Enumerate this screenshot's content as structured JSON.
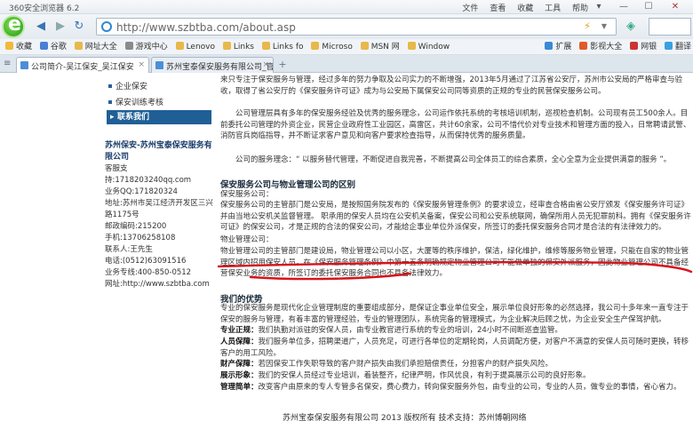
{
  "browser": {
    "title": "360安全浏览器 6.2",
    "menus": [
      "文件",
      "查看",
      "收藏",
      "工具",
      "帮助"
    ],
    "window_controls": [
      "▾",
      "—",
      "☐",
      "✕"
    ],
    "url": "http://www.szbtba.com/about.asp",
    "bookmarks": [
      "收藏",
      "谷歌",
      "网址大全",
      "游戏中心",
      "Lenovo",
      "Links",
      "Links fo",
      "Microso",
      "MSN 网",
      "Window"
    ],
    "bookmarks_right": [
      "扩展",
      "影视大全",
      "网银",
      "翻译"
    ],
    "tabs": [
      {
        "label": "公司简介-吴江保安_吴江保安",
        "active": true
      },
      {
        "label": "苏州宝泰保安服务有限公司_官",
        "active": false
      }
    ]
  },
  "sidebar": {
    "links": [
      "企业保安",
      "保安训练考核"
    ],
    "contact_title": "联系我们",
    "company": "苏州保安-苏州宝泰保安服务有限公司",
    "lines": [
      "客服支持:1718203240qq.com",
      "业务QQ:171820324",
      "地址:苏州市吴江经济开发区三兴路1175号",
      "邮政编码:215200",
      "手机:13706258108",
      "联系人:王先生",
      "电话:(0512)63091516",
      "业务专线:400-850-0512",
      "网址:http://www.szbtba.com"
    ]
  },
  "content": {
    "p1": "来只专注于保安服务与管理，经过多年的努力争取及公司实力的不断增强，2013年5月通过了江苏省公安厅，苏州市公安局的严格审查与验收，取得了省公安厅的《保安服务许可证》成为与公安局下属保安公司同等资质的正规的专业的民营保安服务公司。",
    "p2": "公司管理层具有多年的保安服务经验及优秀的服务理念，公司运作依托系统的考核培训机制，巡视检查机制。公司现有员工500余人。目前委托公司管理的外资企业，民营企业政府性工业园区，高雷区，共计60余家，公司不惜代价对专业技术和管理方面的投入，日常聘请武警、消防官兵岗临指导，并不断证求客户意见和向客户要求检查指导，从而保持优秀的服务质量。",
    "p3": "公司的服务理念：“ 以服务替代管理，不断促进自我完善，不断提高公司全体员工的综合素质，全心全意为企业提供满意的服务 ”。",
    "h1": "保安服务公司与物业管理公司的区别",
    "s1_label": "保安服务公司：",
    "s1": "保安服务公司的主管部门是公安局，是按照国务院发布的《保安服务管理条例》的要求设立，经审查合格由省公安厅颁发《保安服务许可证》并由当地公安机关监督管理。 职承用的保安人员均在公安机关备案，保安公司和公安系统联网，确保所用人员无犯罪前科。拥有《保安服务许可证》的保安公司，才是正规的合法的保安公司，才能给企事业单位外派保安，所签订的委托保安服务合同才是合法的有法律效力的。",
    "s2_label": "物业管理公司：",
    "s2": "物业管理公司的主管部门是建设局，物业管理公司以小区，大厦等的秩序维护，保洁，绿化维护，维修等服务物业管理，只能在自家的物业管理区域内招用保安人员，在《保安服务管理条例》中第十五条明确规定物业管理公司不能做单独的保安外派服务，因此物业管理公司不具备经营保安业务的资质，所签订的委托保安服务合同也不具备法律效力。",
    "h2": "我们的优势",
    "adv_intro": "专业的保安服务是现代化企业管理制度的重要组成部分，是保证企事业单位安全，展示单位良好形象的必然选择，我公司十多年来一直专注于保安的服务与管理，有着丰富的管理经验，专业的管理团队，系统完备的管理模式，为企业解决后顾之忧，为企业安全生产保驾护航。",
    "advantages": [
      {
        "label": "专业正规：",
        "text": "我们执勤对派驻的安保人员，由专业教官进行系统的专业的培训，24小时不间断巡查监管。"
      },
      {
        "label": "人员保障：",
        "text": "我们服务单位多，招聘渠道广，人员充足，可进行各单位的定期轮岗，人员调配方便，对客户不满意的安保人员可随时更换，转移客户的用工风险。"
      },
      {
        "label": "财产保障：",
        "text": "若因保安工作失职导致的客户财产损失由我们承担赔偿责任，分担客户的财产损失风险。"
      },
      {
        "label": "展示形象：",
        "text": "我们的安保人员经过专业培训，着装整齐，纪律严明，作风优良，有利于提高展示公司的良好形象。"
      },
      {
        "label": "管理简单：",
        "text": "改变客户由原来的专人专管多名保安，费心费力，转向保安服务外包，由专业的公司，专业的人员，做专业的事情，省心省力。"
      }
    ],
    "footer": "苏州宝泰保安服务有限公司 2013 版权所有   技术支持：苏州博朝网络"
  },
  "colors": {
    "nav_accent": "#1f5f96",
    "annotation_red": "#d8131b"
  }
}
